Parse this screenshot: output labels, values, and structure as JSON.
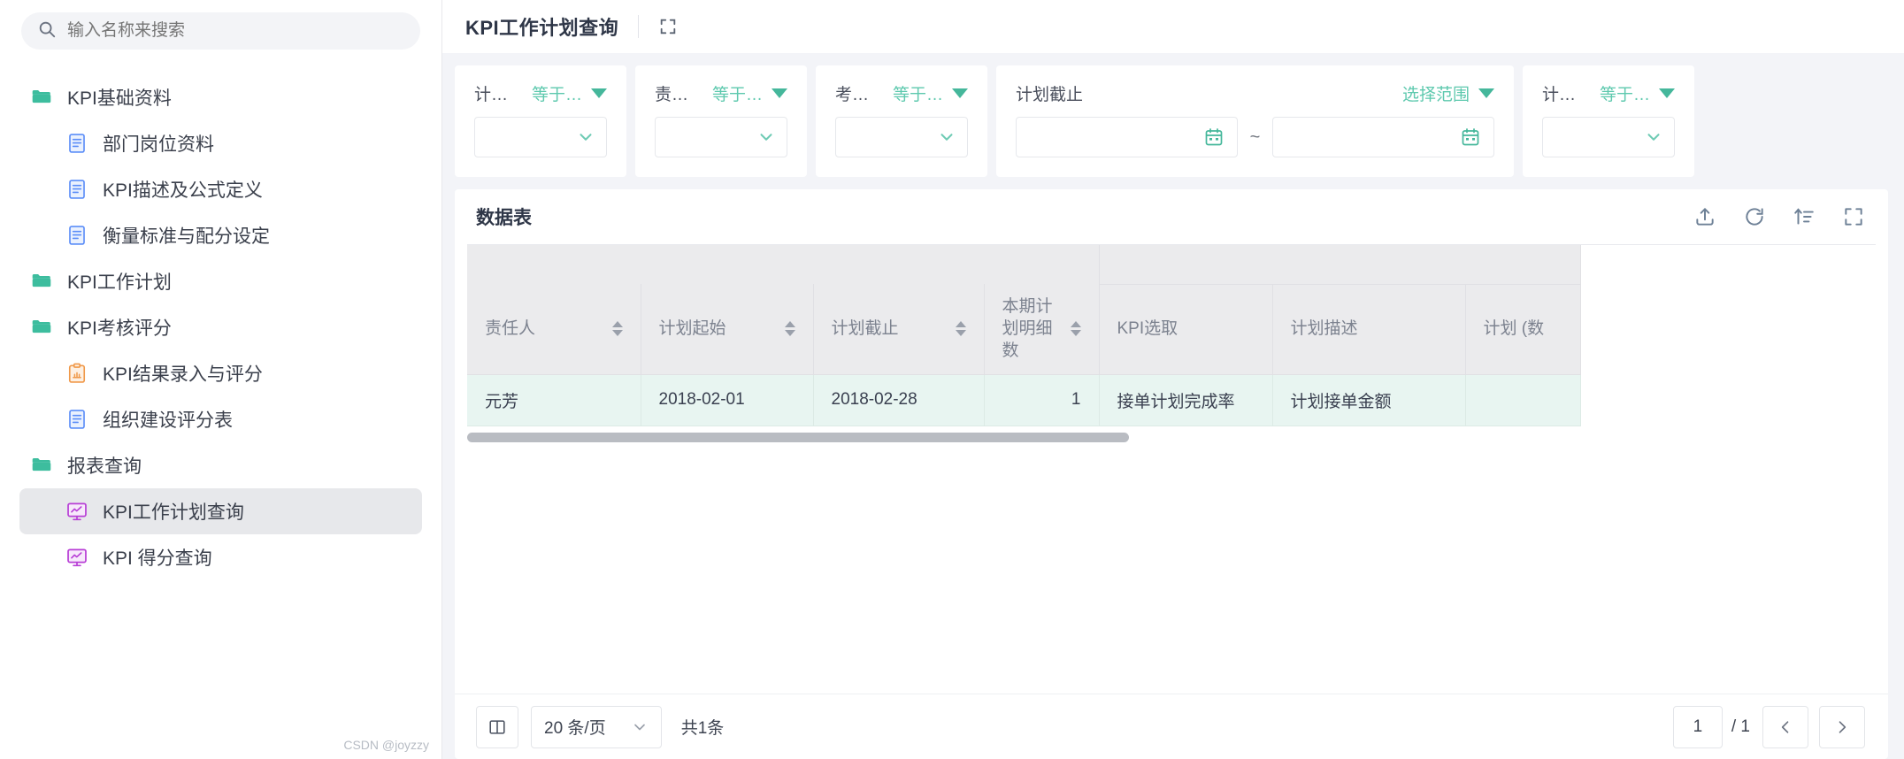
{
  "sidebar": {
    "search": {
      "placeholder": "输入名称来搜索",
      "value": "",
      "icon": "search-icon"
    },
    "items": [
      {
        "label": "KPI基础资料",
        "level": 1,
        "icon": "folder-icon",
        "selected": false
      },
      {
        "label": "部门岗位资料",
        "level": 2,
        "icon": "document-icon",
        "selected": false
      },
      {
        "label": "KPI描述及公式定义",
        "level": 2,
        "icon": "document-icon",
        "selected": false
      },
      {
        "label": "衡量标准与配分设定",
        "level": 2,
        "icon": "document-icon",
        "selected": false
      },
      {
        "label": "KPI工作计划",
        "level": 1,
        "icon": "folder-icon",
        "selected": false
      },
      {
        "label": "KPI考核评分",
        "level": 1,
        "icon": "folder-icon",
        "selected": false
      },
      {
        "label": "KPI结果录入与评分",
        "level": 2,
        "icon": "clipboard-icon",
        "selected": false
      },
      {
        "label": "组织建设评分表",
        "level": 2,
        "icon": "document-icon",
        "selected": false
      },
      {
        "label": "报表查询",
        "level": 1,
        "icon": "folder-icon",
        "selected": false
      },
      {
        "label": "KPI工作计划查询",
        "level": 2,
        "icon": "monitor-chart-icon",
        "selected": true
      },
      {
        "label": "KPI 得分查询",
        "level": 2,
        "icon": "monitor-chart-icon",
        "selected": false
      }
    ]
  },
  "header": {
    "title": "KPI工作计划查询",
    "expand_icon": "expand-icon"
  },
  "filters": [
    {
      "type": "select",
      "name": "计…",
      "operator": "等于…",
      "value": ""
    },
    {
      "type": "select",
      "name": "责…",
      "operator": "等于…",
      "value": ""
    },
    {
      "type": "select",
      "name": "考…",
      "operator": "等于…",
      "value": ""
    },
    {
      "type": "daterange",
      "name": "计划截止",
      "operator": "选择范围",
      "start": "",
      "end": "",
      "separator": "~"
    },
    {
      "type": "select",
      "name": "计…",
      "operator": "等于…",
      "value": ""
    }
  ],
  "table_panel": {
    "title": "数据表",
    "tools": [
      {
        "icon": "upload-icon",
        "label": "导出"
      },
      {
        "icon": "refresh-icon",
        "label": "刷新"
      },
      {
        "icon": "sort-icon",
        "label": "排序"
      },
      {
        "icon": "fullscreen-icon",
        "label": "全屏"
      }
    ],
    "group_headers": [
      {
        "label": "",
        "colspan": 4
      },
      {
        "label": "",
        "colspan": 3
      }
    ],
    "columns": [
      {
        "label": "责任人",
        "sortable": true,
        "align": "left"
      },
      {
        "label": "计划起始",
        "sortable": true,
        "align": "left"
      },
      {
        "label": "计划截止",
        "sortable": true,
        "align": "left"
      },
      {
        "label": "本期计划明细数",
        "sortable": true,
        "align": "left"
      },
      {
        "label": "KPI选取",
        "sortable": false,
        "align": "left"
      },
      {
        "label": "计划描述",
        "sortable": false,
        "align": "left"
      },
      {
        "label": "计划\n(数",
        "sortable": false,
        "align": "left"
      }
    ],
    "rows": [
      {
        "责任人": "元芳",
        "计划起始": "2018-02-01",
        "计划截止": "2018-02-28",
        "本期计划明细数": "1",
        "KPI选取": "接单计划完成率",
        "计划描述": "计划接单金额",
        "计划数": ""
      }
    ]
  },
  "pagination": {
    "columns_icon": "columns-icon",
    "page_size": "20 条/页",
    "total_text": "共1条",
    "current_page": "1",
    "page_separator": "/",
    "total_pages": "1",
    "prev_icon": "chevron-left-icon",
    "next_icon": "chevron-right-icon"
  },
  "watermark": "CSDN @joyzzy",
  "colors": {
    "accent_teal": "#45b79b",
    "operator_text": "#5ec9ae",
    "row_highlight": "#e8f5f1",
    "header_bg": "#ebebed",
    "selected_nav": "#e7e8eb"
  }
}
